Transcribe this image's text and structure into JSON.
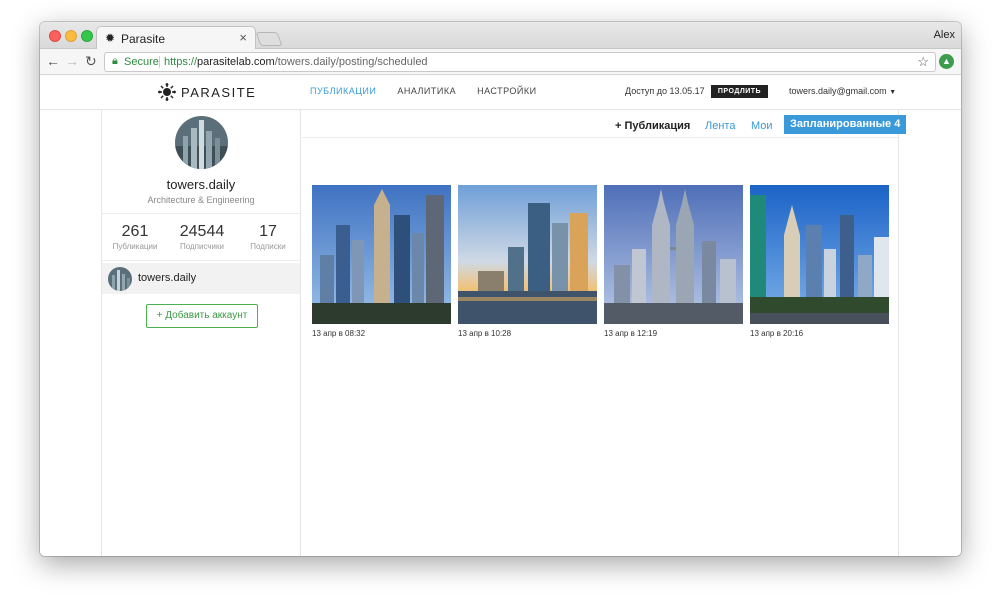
{
  "browser": {
    "tab_title": "Parasite",
    "profile_name": "Alex",
    "secure_label": "Secure",
    "url_scheme": "https://",
    "url_host": "parasitelab.com",
    "url_path": "/towers.daily/posting/scheduled"
  },
  "header": {
    "logo_text": "PARASITE",
    "nav": [
      "ПУБЛИКАЦИИ",
      "АНАЛИТИКА",
      "НАСТРОЙКИ"
    ],
    "active_nav_index": 0,
    "access_text": "Доступ до 13.05.17",
    "renew_label": "ПРОДЛИТЬ",
    "email": "towers.daily@gmail.com"
  },
  "profile": {
    "username": "towers.daily",
    "category": "Architecture & Engineering",
    "stats": [
      {
        "value": "261",
        "label": "Публикации"
      },
      {
        "value": "24544",
        "label": "Подписчики"
      },
      {
        "value": "17",
        "label": "Подписки"
      }
    ],
    "account_name": "towers.daily",
    "add_account_label": "+ Добавить аккаунт"
  },
  "subnav": {
    "new_post": "+ Публикация",
    "feed": "Лента",
    "mine": "Мои",
    "scheduled": "Запланированные 4"
  },
  "posts": [
    {
      "date": "13 апр в 08:32"
    },
    {
      "date": "13 апр в 10:28"
    },
    {
      "date": "13 апр в 12:19"
    },
    {
      "date": "13 апр в 20:16"
    }
  ],
  "colors": {
    "accent": "#3a9ad9",
    "green": "#3d9a46"
  }
}
